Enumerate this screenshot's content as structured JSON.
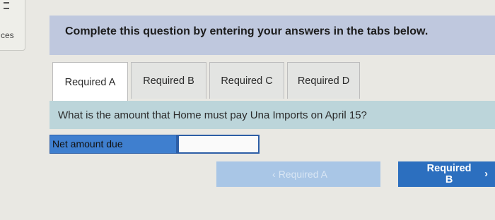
{
  "sidebar": {
    "fragment": "ces"
  },
  "instructions": "Complete this question by entering your answers in the tabs below.",
  "tabs": [
    {
      "label": "Required A",
      "active": true
    },
    {
      "label": "Required B",
      "active": false
    },
    {
      "label": "Required C",
      "active": false
    },
    {
      "label": "Required D",
      "active": false
    }
  ],
  "question": "What is the amount that Home must pay Una Imports on April 15?",
  "answer": {
    "label": "Net amount due",
    "value": ""
  },
  "nav": {
    "prev_label": "Required A",
    "prev_icon": "chevron-left-icon",
    "next_label": "Required B",
    "next_icon": "chevron-right-icon"
  },
  "colors": {
    "banner": "#bfc8de",
    "question_bar": "#bcd5da",
    "label_fill": "#3f7fcf",
    "next_button": "#2c6fbf",
    "prev_button_disabled": "#a9c6e6"
  }
}
